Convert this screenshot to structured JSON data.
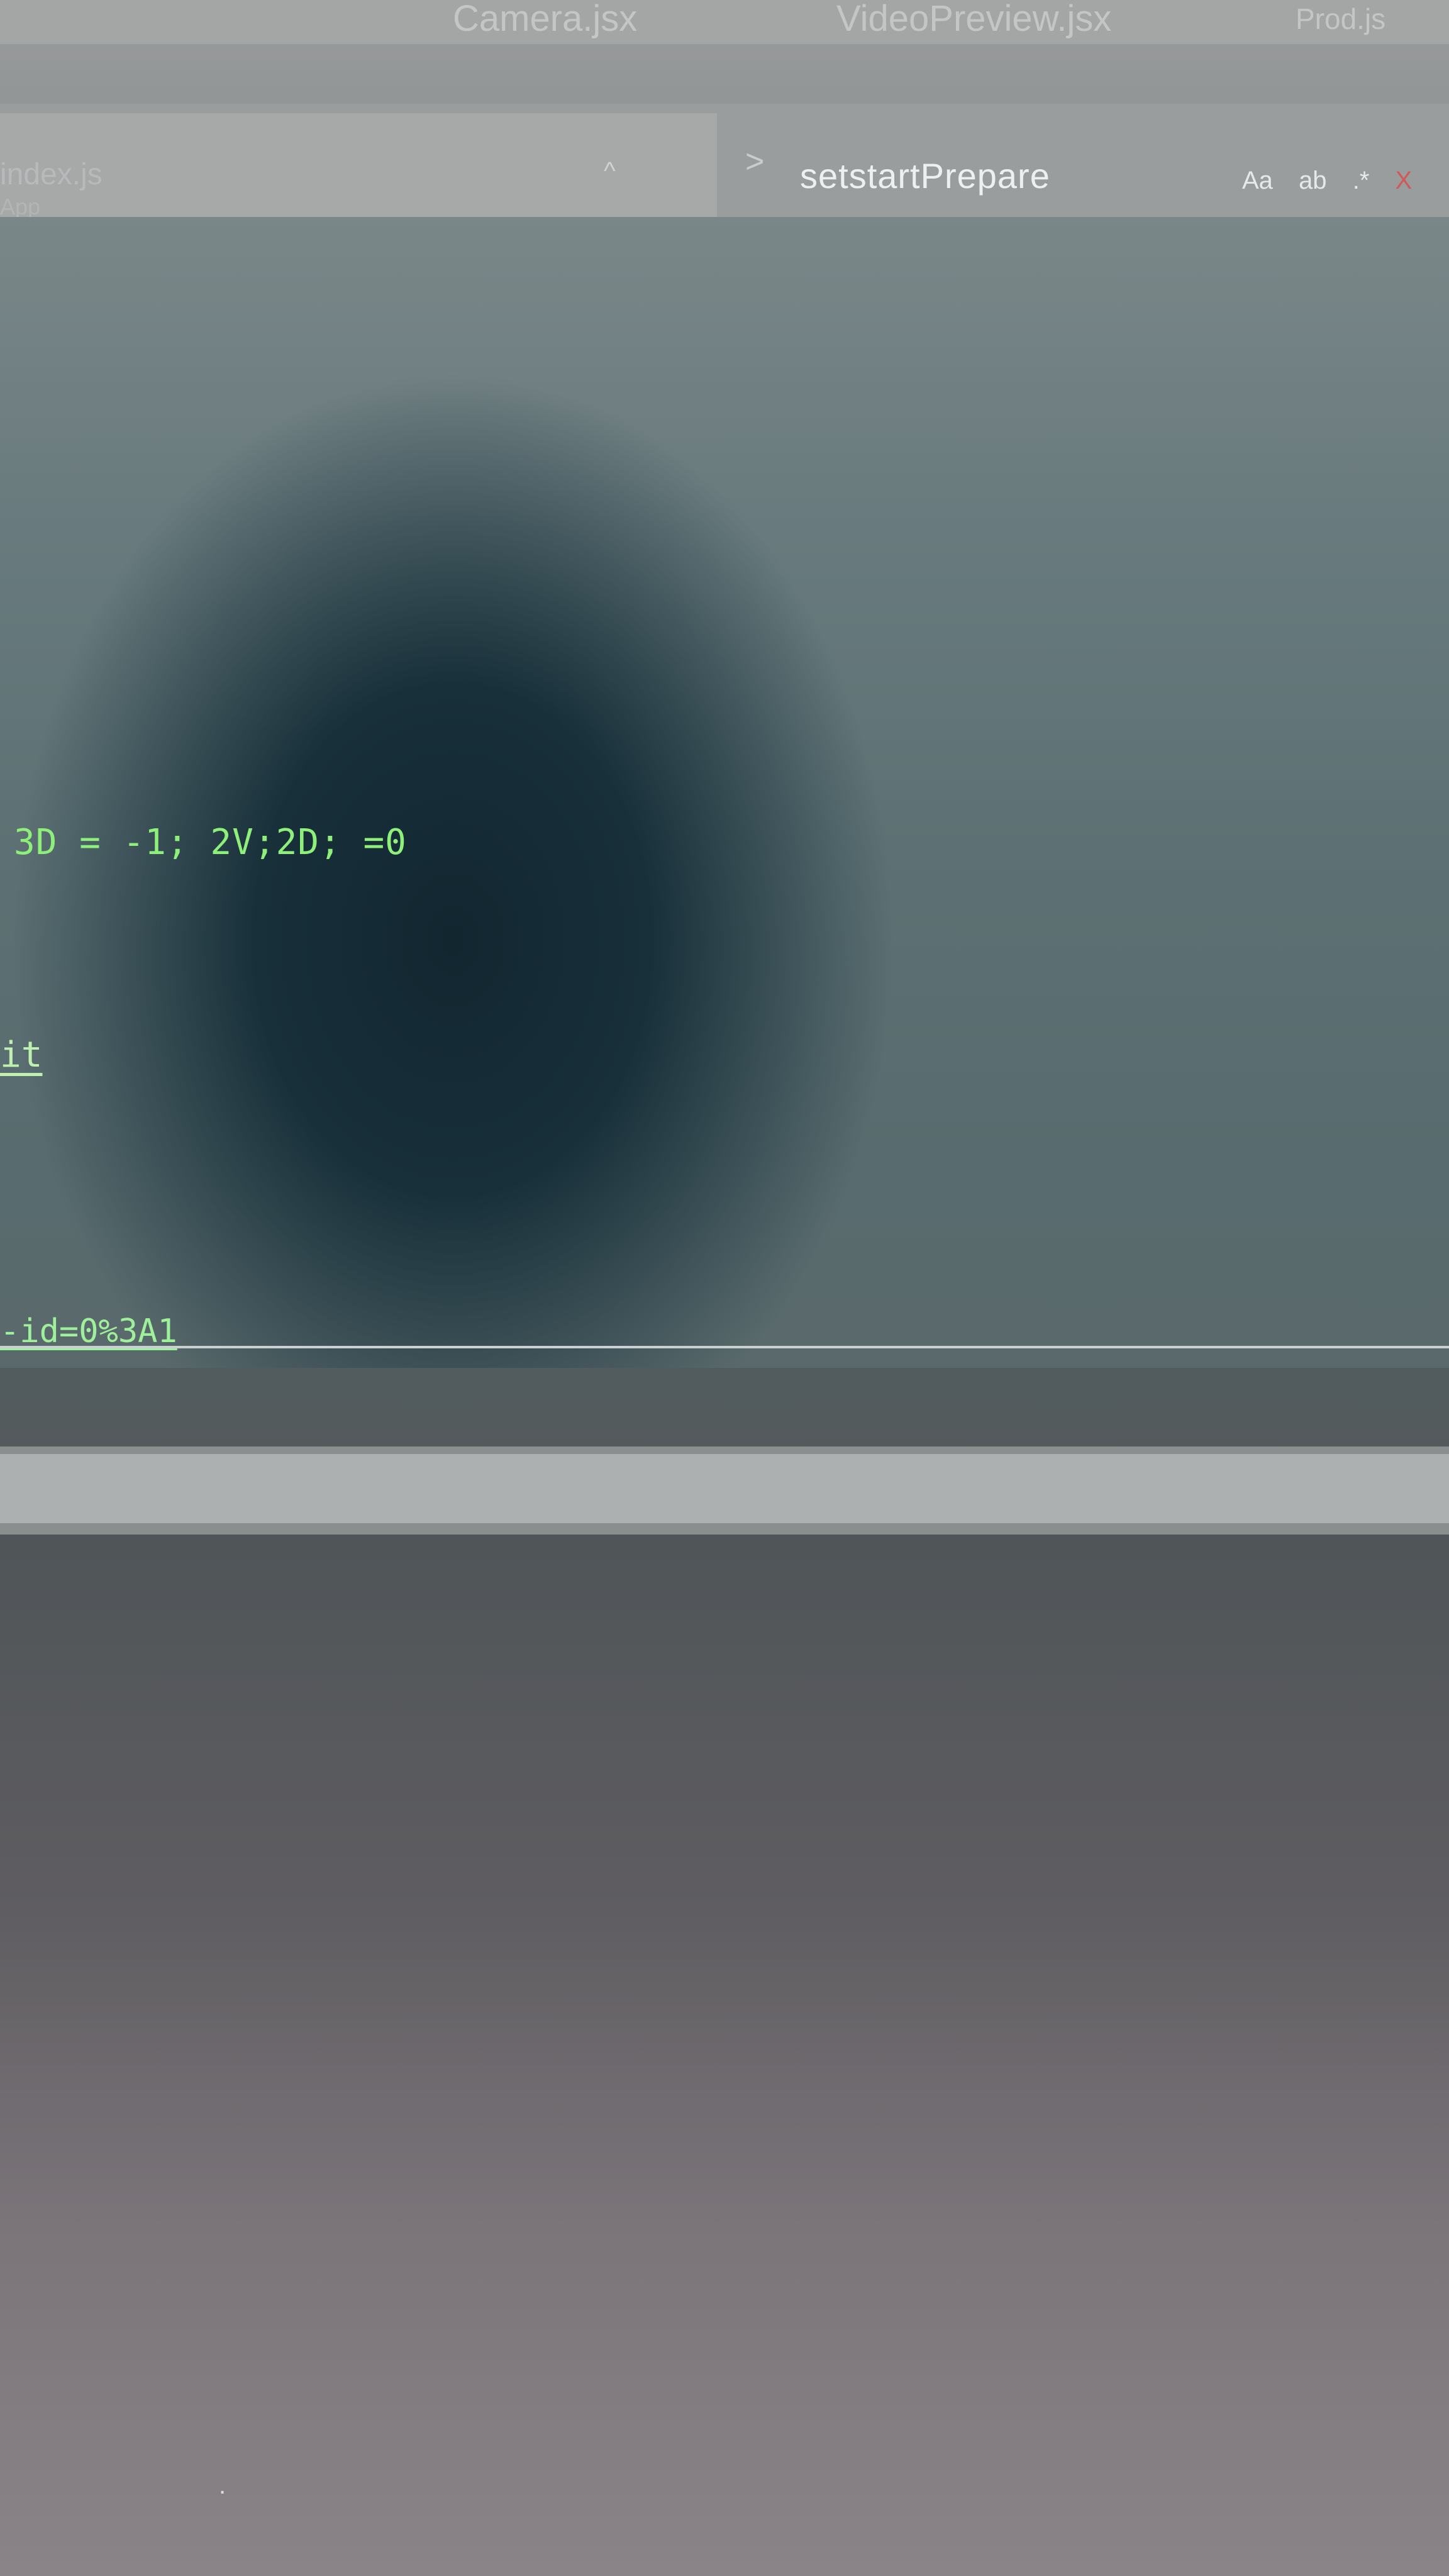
{
  "tabs": [
    {
      "label": "Camera.jsx"
    },
    {
      "label": "VideoPreview.jsx"
    },
    {
      "label": "Prod.js"
    }
  ],
  "breadcrumb": {
    "file": "index.js",
    "sub": "App",
    "up_glyph": "^",
    "separator": ">",
    "symbol": "setstartPrepare"
  },
  "find": {
    "match_case": "Aa",
    "whole_word": "ab",
    "regex": ".*",
    "close": "X"
  },
  "editor": {
    "code_line": "3D  = -1; 2V;2D; =0",
    "link_tail": "it",
    "url_tail": "-id=0%3A1"
  },
  "bottom": {
    "glyph": "."
  },
  "colors": {
    "terminal_text": "#8ef07a",
    "tab_bar": "#a4a6a5",
    "scrollbar_thumb": "#adb0b0"
  }
}
